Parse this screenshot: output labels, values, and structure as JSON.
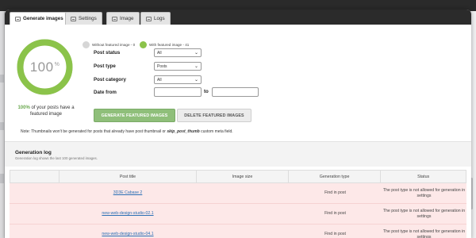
{
  "tabs": [
    {
      "label": "Generate images",
      "icon": "image-icon"
    },
    {
      "label": "Settings",
      "icon": "settings-icon"
    },
    {
      "label": "Image",
      "icon": "image-icon"
    },
    {
      "label": "Logs",
      "icon": "logs-icon"
    }
  ],
  "progress": {
    "value": 100,
    "number_text": "100",
    "percent_sign": "%",
    "caption_highlight": "100%",
    "caption_rest": " of your posts have a featured image"
  },
  "legend": {
    "without": {
      "label": "Without featured image - 0",
      "color": "#d6d6d6"
    },
    "with": {
      "label": "With featured image - 41",
      "color": "#8bc34a"
    }
  },
  "form": {
    "post_status": {
      "label": "Post status",
      "value": "All"
    },
    "post_type": {
      "label": "Post type",
      "value": "Posts"
    },
    "post_category": {
      "label": "Post category",
      "value": "All"
    },
    "date_from": {
      "label": "Date from",
      "to_label": "to",
      "from_value": "",
      "to_value": ""
    }
  },
  "buttons": {
    "generate": "Generate featured images",
    "delete": "Delete featured images"
  },
  "note": {
    "prefix": "Note: Thumbnails won't be generated for posts that already have post thumbnail or ",
    "emphasis": "skip_post_thumb",
    "suffix": " custom meta field."
  },
  "log": {
    "title": "Generation log",
    "subtitle": "Generation log shows the last 100 generated images.",
    "columns": [
      "",
      "Post title",
      "Image size",
      "Generation type",
      "Status"
    ],
    "rows": [
      {
        "title": "3D3E Cabase 2",
        "size": "",
        "type": "Find in post",
        "status": "The post type is not allowed for generation in settings"
      },
      {
        "title": "new-web-design-studio-02.1",
        "size": "",
        "type": "Find in post",
        "status": "The post type is not allowed for generation in settings"
      },
      {
        "title": "new-web-design-studio-04.1",
        "size": "",
        "type": "Find in post",
        "status": "The post type is not allowed for generation in settings"
      }
    ]
  },
  "colors": {
    "accent_green": "#8bc34a",
    "button_green": "#8fbf7a",
    "row_error_bg": "#fde8e8",
    "link_blue": "#2a6fb5"
  }
}
